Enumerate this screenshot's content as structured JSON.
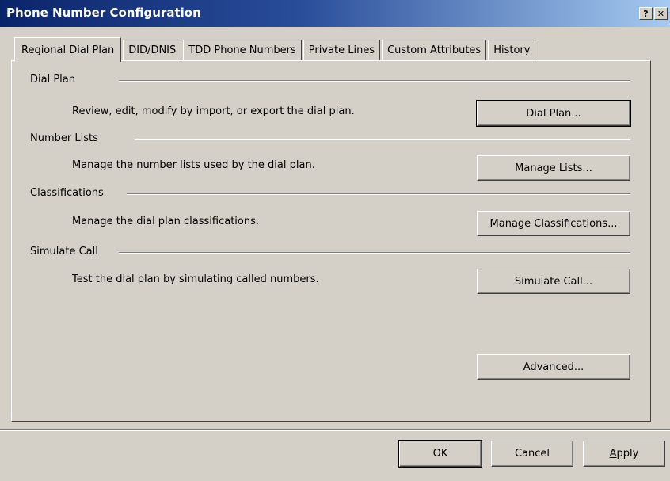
{
  "window": {
    "title": "Phone Number Configuration",
    "help_button": "?",
    "close_button": "✕"
  },
  "tabs": [
    {
      "label": "Regional Dial Plan",
      "active": true
    },
    {
      "label": "DID/DNIS",
      "active": false
    },
    {
      "label": "TDD Phone Numbers",
      "active": false
    },
    {
      "label": "Private Lines",
      "active": false
    },
    {
      "label": "Custom Attributes",
      "active": false
    },
    {
      "label": "History",
      "active": false
    }
  ],
  "groups": {
    "dial_plan": {
      "label": "Dial Plan",
      "description": "Review, edit, modify by import, or export the dial plan.",
      "button": "Dial Plan..."
    },
    "number_lists": {
      "label": "Number Lists",
      "description": "Manage the number lists used by the dial plan.",
      "button": "Manage Lists..."
    },
    "classifications": {
      "label": "Classifications",
      "description": "Manage the dial plan classifications.",
      "button": "Manage Classifications..."
    },
    "simulate_call": {
      "label": "Simulate Call",
      "description": "Test the dial plan by simulating called numbers.",
      "button": "Simulate Call..."
    }
  },
  "advanced_button": "Advanced...",
  "footer": {
    "ok": "OK",
    "cancel": "Cancel",
    "apply_prefix": "A",
    "apply_rest": "pply"
  }
}
